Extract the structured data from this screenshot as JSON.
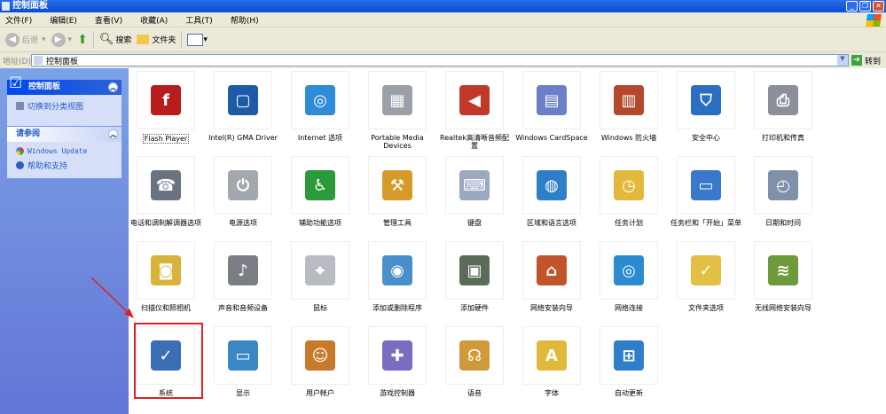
{
  "window": {
    "title": "控制面板",
    "buttons": {
      "minimize": "_",
      "restore": "❐",
      "close": "✕"
    }
  },
  "menu": [
    "文件(F)",
    "编辑(E)",
    "查看(V)",
    "收藏(A)",
    "工具(T)",
    "帮助(H)"
  ],
  "toolbar": {
    "back": "后退",
    "search": "搜索",
    "folders": "文件夹"
  },
  "address": {
    "label": "地址(D)",
    "value": "控制面板",
    "go": "转到"
  },
  "sidebar": {
    "panel1": {
      "title": "控制面板",
      "items": [
        "切换到分类视图"
      ]
    },
    "panel2": {
      "title": "请参阅",
      "items": [
        "Windows Update",
        "帮助和支持"
      ]
    }
  },
  "items": [
    {
      "label": "Flash Player",
      "color": "#b81c1c",
      "glyph": "f"
    },
    {
      "label": "Intel(R) GMA Driver",
      "color": "#1d5aa8",
      "glyph": "▢"
    },
    {
      "label": "Internet 选项",
      "color": "#2e8bd8",
      "glyph": "◎"
    },
    {
      "label": "Portable Media Devices",
      "color": "#9aa0a8",
      "glyph": "▦"
    },
    {
      "label": "Realtek高清晰音频配置",
      "color": "#c0392b",
      "glyph": "◀"
    },
    {
      "label": "Windows CardSpace",
      "color": "#6c7fc9",
      "glyph": "▤"
    },
    {
      "label": "Windows 防火墙",
      "color": "#b5472c",
      "glyph": "▥"
    },
    {
      "label": "安全中心",
      "color": "#2a6fc1",
      "glyph": "⛉"
    },
    {
      "label": "打印机和传真",
      "color": "#8a8f99",
      "glyph": "⎙"
    },
    {
      "label": "电话和调制解调器选项",
      "color": "#6a7480",
      "glyph": "☎"
    },
    {
      "label": "电源选项",
      "color": "#a3a8ae",
      "glyph": "⏻"
    },
    {
      "label": "辅助功能选项",
      "color": "#2b9a3b",
      "glyph": "♿"
    },
    {
      "label": "管理工具",
      "color": "#d49b2a",
      "glyph": "⚒"
    },
    {
      "label": "键盘",
      "color": "#9aa8c0",
      "glyph": "⌨"
    },
    {
      "label": "区域和语言选项",
      "color": "#2f7fc8",
      "glyph": "◍"
    },
    {
      "label": "任务计划",
      "color": "#e3b93b",
      "glyph": "◷"
    },
    {
      "label": "任务栏和「开始」菜单",
      "color": "#3a78c9",
      "glyph": "▭"
    },
    {
      "label": "日期和时间",
      "color": "#8090a8",
      "glyph": "◴"
    },
    {
      "label": "扫描仪和照相机",
      "color": "#d7b33a",
      "glyph": "◙"
    },
    {
      "label": "声音和音频设备",
      "color": "#7a7f86",
      "glyph": "♪"
    },
    {
      "label": "鼠标",
      "color": "#b8bcc2",
      "glyph": "⌖"
    },
    {
      "label": "添加或删除程序",
      "color": "#4a8fcb",
      "glyph": "◉"
    },
    {
      "label": "添加硬件",
      "color": "#5b6c5b",
      "glyph": "▣"
    },
    {
      "label": "网络安装向导",
      "color": "#c2542b",
      "glyph": "⌂"
    },
    {
      "label": "网络连接",
      "color": "#2c8ad0",
      "glyph": "◎"
    },
    {
      "label": "文件夹选项",
      "color": "#e2c046",
      "glyph": "✓"
    },
    {
      "label": "无线网络安装向导",
      "color": "#6d9a3a",
      "glyph": "≋"
    },
    {
      "label": "系统",
      "color": "#3b6fb5",
      "glyph": "✓"
    },
    {
      "label": "显示",
      "color": "#3b87c4",
      "glyph": "▭"
    },
    {
      "label": "用户帐户",
      "color": "#c77b2a",
      "glyph": "☺"
    },
    {
      "label": "游戏控制器",
      "color": "#7b6cc0",
      "glyph": "✚"
    },
    {
      "label": "语音",
      "color": "#d09a3a",
      "glyph": "☊"
    },
    {
      "label": "字体",
      "color": "#e0b83a",
      "glyph": "A"
    },
    {
      "label": "自动更新",
      "color": "#2f7fc8",
      "glyph": "⊞"
    }
  ]
}
